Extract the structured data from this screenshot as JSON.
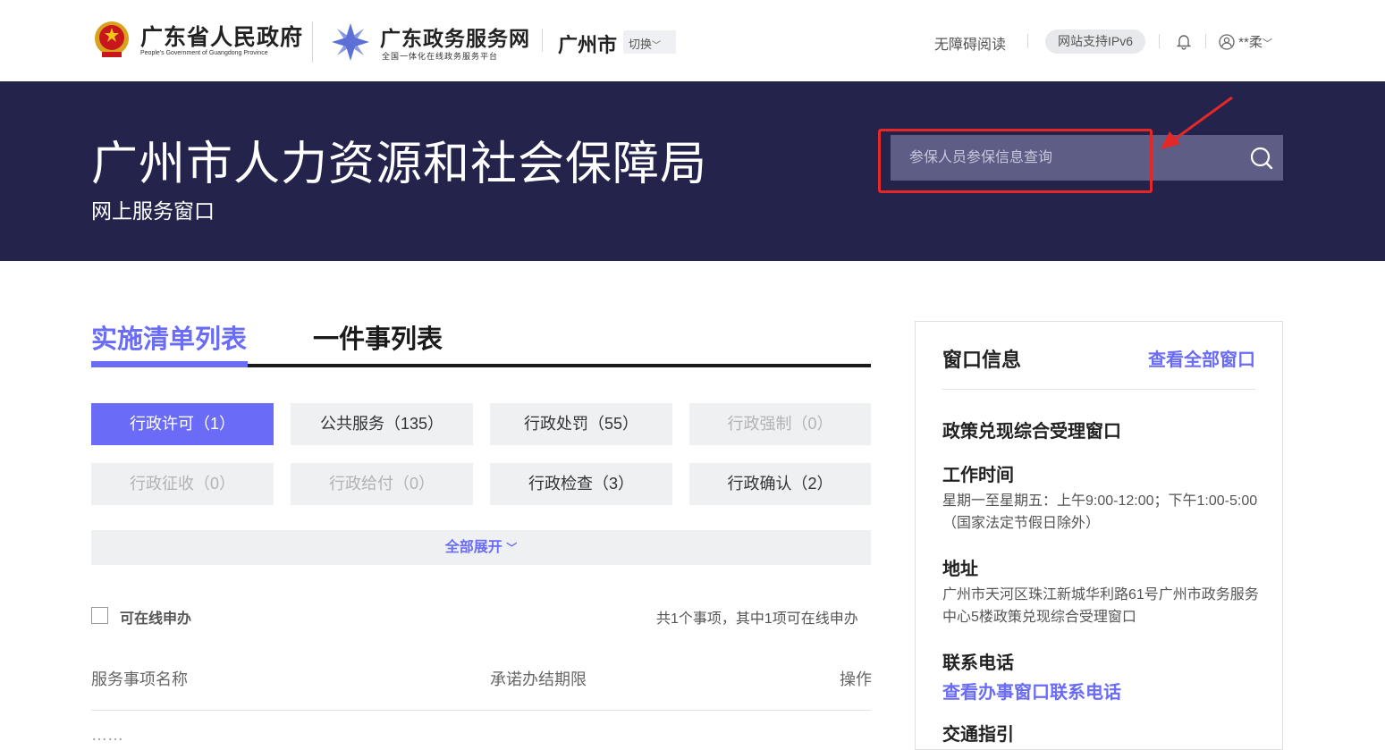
{
  "header": {
    "gov_title": "广东省人民政府",
    "gov_subtitle": "People's Government of Guangdong Province",
    "service_title": "广东政务服务网",
    "service_subtitle": "全国一体化在线政务服务平台",
    "city": "广州市",
    "switch_label": "切换",
    "accessibility": "无障碍阅读",
    "ipv6": "网站支持IPv6",
    "user_name": "**柔"
  },
  "banner": {
    "title": "广州市人力资源和社会保障局",
    "subtitle": "网上服务窗口",
    "search_placeholder": "参保人员参保信息查询"
  },
  "tabs": [
    {
      "label": "实施清单列表"
    },
    {
      "label": "一件事列表"
    }
  ],
  "categories": [
    {
      "label": "行政许可（1）"
    },
    {
      "label": "公共服务（135）"
    },
    {
      "label": "行政处罚（55）"
    },
    {
      "label": "行政强制（0）"
    },
    {
      "label": "行政征收（0）"
    },
    {
      "label": "行政给付（0）"
    },
    {
      "label": "行政检查（3）"
    },
    {
      "label": "行政确认（2）"
    }
  ],
  "expand_label": "全部展开",
  "filter": {
    "online_label": "可在线申办",
    "count_text": "共1个事项，其中1项可在线申办"
  },
  "table": {
    "columns": [
      "服务事项名称",
      "承诺办结期限",
      "操作"
    ],
    "first_row_partial": "……"
  },
  "panel": {
    "title": "窗口信息",
    "view_all": "查看全部窗口",
    "window_name": "政策兑现综合受理窗口",
    "hours_label": "工作时间",
    "hours_text": "星期一至星期五：上午9:00-12:00；下午1:00-5:00（国家法定节假日除外）",
    "address_label": "地址",
    "address_text": "广州市天河区珠江新城华利路61号广州市政务服务中心5楼政策兑现综合受理窗口",
    "phone_label": "联系电话",
    "phone_link": "查看办事窗口联系电话",
    "traffic_label": "交通指引"
  },
  "colors": {
    "accent": "#6a6cf7",
    "banner_bg": "#23234c",
    "highlight_red": "#e42828"
  }
}
